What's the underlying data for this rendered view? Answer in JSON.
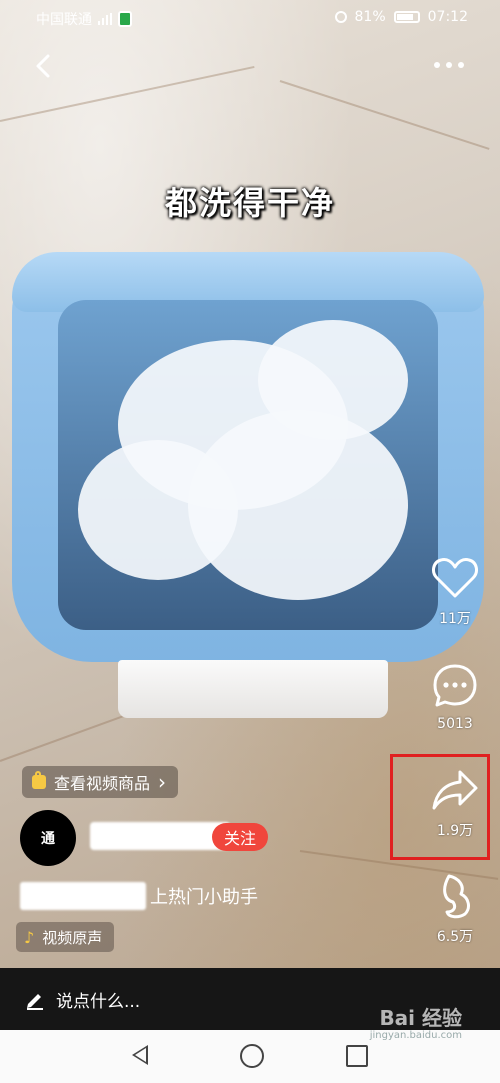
{
  "status_bar": {
    "carrier": "中国联通",
    "battery": "81%",
    "time": "07:12"
  },
  "video": {
    "caption": "都洗得干净"
  },
  "actions": {
    "like_count": "11万",
    "comment_count": "5013",
    "share_count": "1.9万",
    "extra_count": "6.5万"
  },
  "product": {
    "label": "查看视频商品",
    "chevron": "›"
  },
  "author": {
    "avatar_text": "通",
    "follow_label": "关注"
  },
  "description": {
    "text": "上热门小助手"
  },
  "music": {
    "label": "视频原声"
  },
  "comment_bar": {
    "placeholder": "说点什么..."
  },
  "watermark": {
    "text": "Bai 经验",
    "sub": "jingyan.baidu.com"
  },
  "colors": {
    "follow_bg": "#f0463c",
    "highlight": "#e02020",
    "product_icon": "#f6c944"
  }
}
